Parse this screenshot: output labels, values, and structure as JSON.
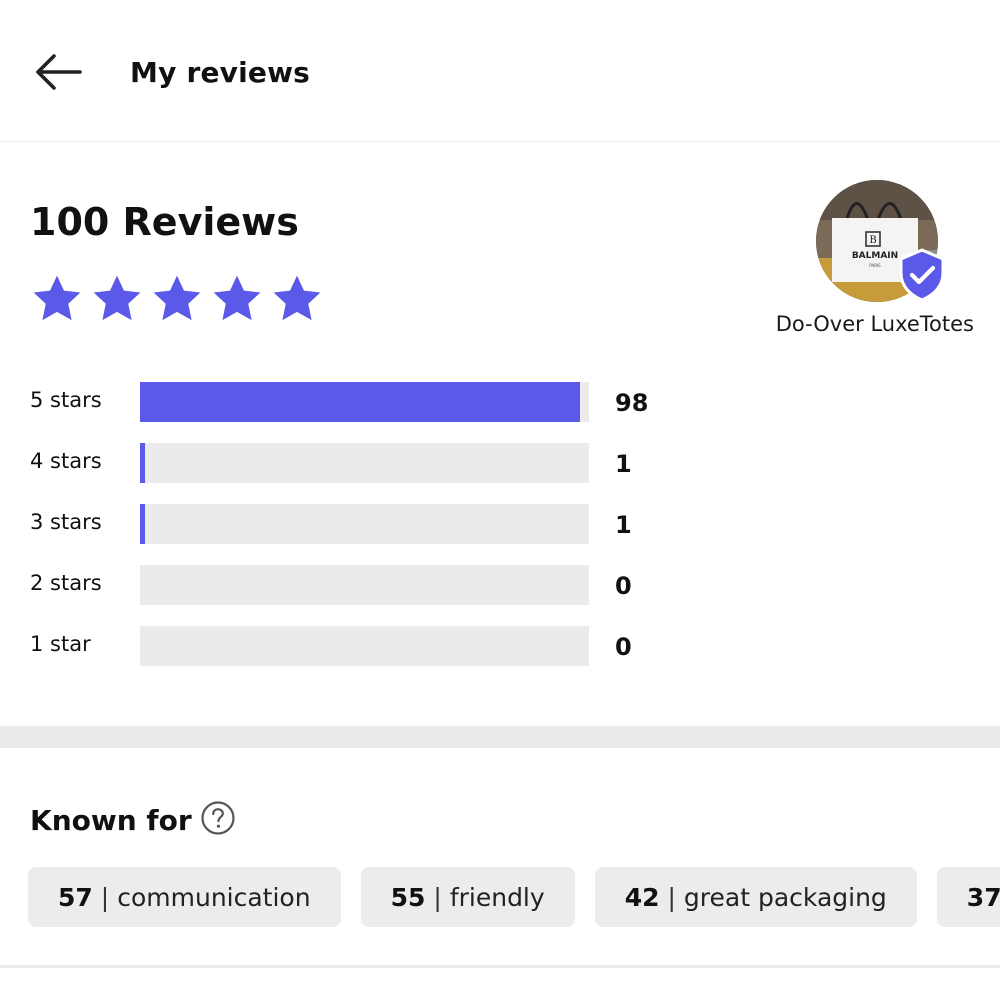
{
  "header": {
    "back_icon": "arrow-left-icon",
    "title": "My reviews"
  },
  "summary": {
    "count_text": "100 Reviews",
    "rating": 5,
    "star_color": "#5b5ae8",
    "seller": {
      "name": "Do-Over LuxeTotes",
      "avatar_bag_brand": "BALMAIN",
      "avatar_bag_sub": "PARIS",
      "verified_icon": "verified-shield-check-icon",
      "verified_color": "#5b5ae8"
    },
    "distribution": [
      {
        "label": "5 stars",
        "count": "98",
        "fraction": 0.98
      },
      {
        "label": "4 stars",
        "count": "1",
        "fraction": 0.01
      },
      {
        "label": "3 stars",
        "count": "1",
        "fraction": 0.01
      },
      {
        "label": "2 stars",
        "count": "0",
        "fraction": 0
      },
      {
        "label": "1 star",
        "count": "0",
        "fraction": 0
      }
    ]
  },
  "known_for": {
    "title": "Known for",
    "help_icon": "question-circle-icon",
    "tags": [
      {
        "count": "57",
        "sep": "|",
        "label": "communication"
      },
      {
        "count": "55",
        "sep": "|",
        "label": "friendly"
      },
      {
        "count": "42",
        "sep": "|",
        "label": "great packaging"
      },
      {
        "count": "37",
        "sep": "",
        "label": ""
      }
    ]
  }
}
